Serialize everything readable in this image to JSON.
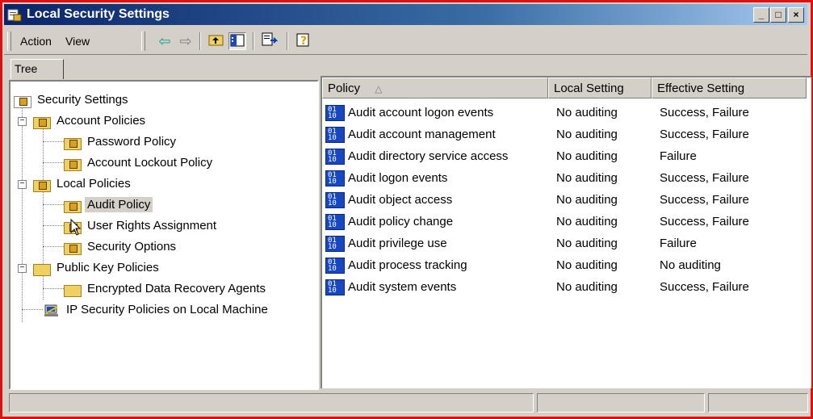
{
  "window": {
    "title": "Local Security Settings",
    "buttons": [
      "_",
      "□",
      "×"
    ]
  },
  "toolbar": {
    "action_label": "Action",
    "view_label": "View"
  },
  "tree": {
    "tab_label": "Tree",
    "nodes": [
      {
        "label": "Security Settings"
      },
      {
        "label": "Account Policies"
      },
      {
        "label": "Password Policy"
      },
      {
        "label": "Account Lockout Policy"
      },
      {
        "label": "Local Policies"
      },
      {
        "label": "Audit Policy"
      },
      {
        "label": "User Rights Assignment"
      },
      {
        "label": "Security Options"
      },
      {
        "label": "Public Key Policies"
      },
      {
        "label": "Encrypted Data Recovery Agents"
      },
      {
        "label": "IP Security Policies on Local Machine"
      }
    ]
  },
  "list": {
    "columns": [
      "Policy",
      "Local Setting",
      "Effective Setting"
    ],
    "sort_indicator": "△",
    "rows": [
      {
        "policy": "Audit account logon events",
        "local": "No auditing",
        "effective": "Success, Failure"
      },
      {
        "policy": "Audit account management",
        "local": "No auditing",
        "effective": "Success, Failure"
      },
      {
        "policy": "Audit directory service access",
        "local": "No auditing",
        "effective": "Failure"
      },
      {
        "policy": "Audit logon events",
        "local": "No auditing",
        "effective": "Success, Failure"
      },
      {
        "policy": "Audit object access",
        "local": "No auditing",
        "effective": "Success, Failure"
      },
      {
        "policy": "Audit policy change",
        "local": "No auditing",
        "effective": "Success, Failure"
      },
      {
        "policy": "Audit privilege use",
        "local": "No auditing",
        "effective": "Failure"
      },
      {
        "policy": "Audit process tracking",
        "local": "No auditing",
        "effective": "No auditing"
      },
      {
        "policy": "Audit system events",
        "local": "No auditing",
        "effective": "Success, Failure"
      }
    ]
  },
  "colors": {
    "border_accent": "#e01010",
    "title_start": "#0a246a",
    "title_end": "#a6caf0",
    "selection": "#d4d0c8"
  }
}
